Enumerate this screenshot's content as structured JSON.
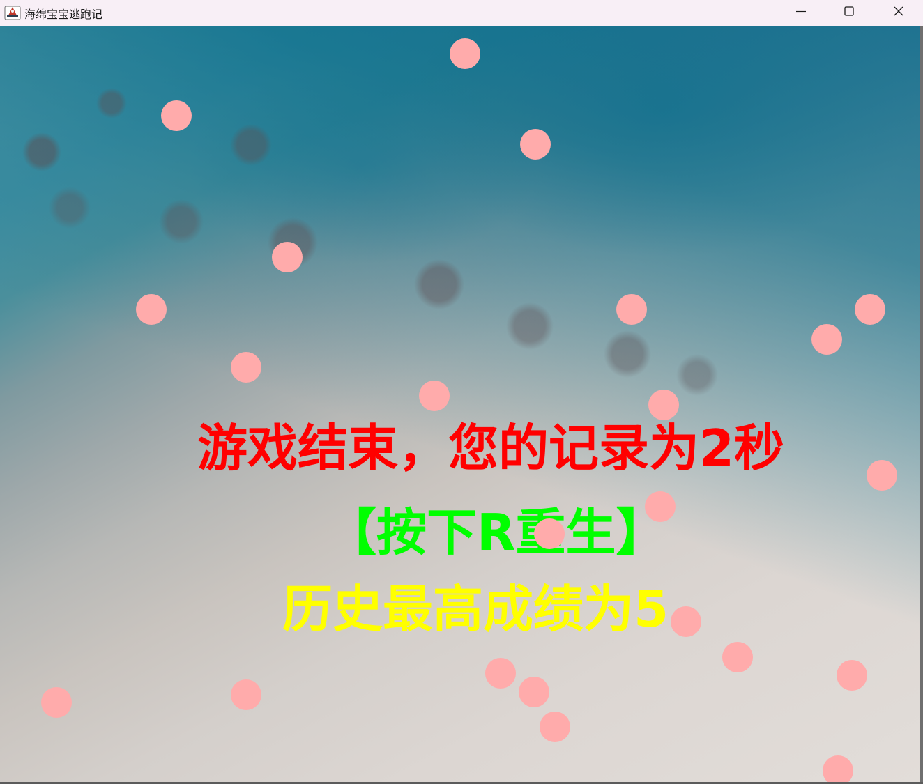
{
  "window": {
    "title": "海绵宝宝逃跑记",
    "icon": "java-app-icon",
    "controls": {
      "minimize_icon": "minimize-icon",
      "maximize_icon": "maximize-icon",
      "close_icon": "close-icon"
    }
  },
  "game": {
    "background": "seabed-reef-aerial",
    "enemy_color": "#ffabab",
    "messages": {
      "game_over": "游戏结束，您的记录为2秒",
      "respawn_hint": "【按下R重生】",
      "best_score": "历史最高成绩为5"
    },
    "message_colors": {
      "game_over": "#ff0000",
      "respawn_hint": "#00ff00",
      "best_score": "#ffff00"
    },
    "enemy_count": 24
  }
}
